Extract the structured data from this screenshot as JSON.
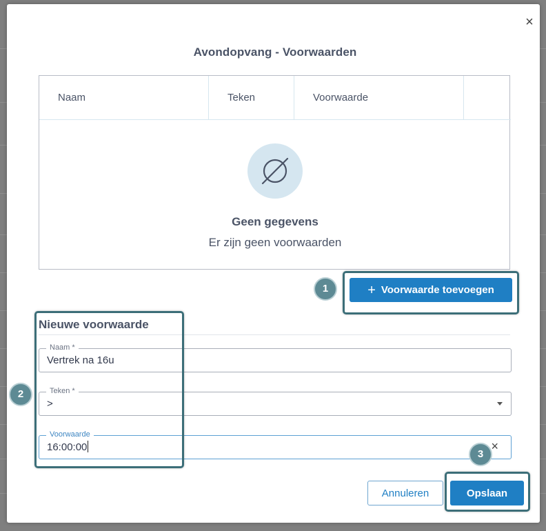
{
  "modal": {
    "title": "Avondopvang - Voorwaarden",
    "close_symbol": "×"
  },
  "table": {
    "columns": [
      "Naam",
      "Teken",
      "Voorwaarde",
      ""
    ],
    "empty_icon": "empty-set-icon",
    "empty_title": "Geen gegevens",
    "empty_subtitle": "Er zijn geen voorwaarden"
  },
  "add_button": {
    "icon": "plus-icon",
    "label": "Voorwaarde toevoegen"
  },
  "form": {
    "section_title": "Nieuwe voorwaarde",
    "naam": {
      "label": "Naam *",
      "value": "Vertrek na 16u"
    },
    "teken": {
      "label": "Teken *",
      "value": ">"
    },
    "voorwaarde": {
      "label": "Voorwaarde",
      "value": "16:00:00"
    }
  },
  "footer": {
    "cancel_label": "Annuleren",
    "save_label": "Opslaan"
  },
  "annotations": {
    "badge_1": "1",
    "badge_2": "2",
    "badge_3": "3"
  },
  "colors": {
    "primary": "#1f7fc4",
    "annotation": "#3c6e78",
    "badge": "#5d8a94",
    "empty_icon_bg": "#d5e6f0"
  }
}
